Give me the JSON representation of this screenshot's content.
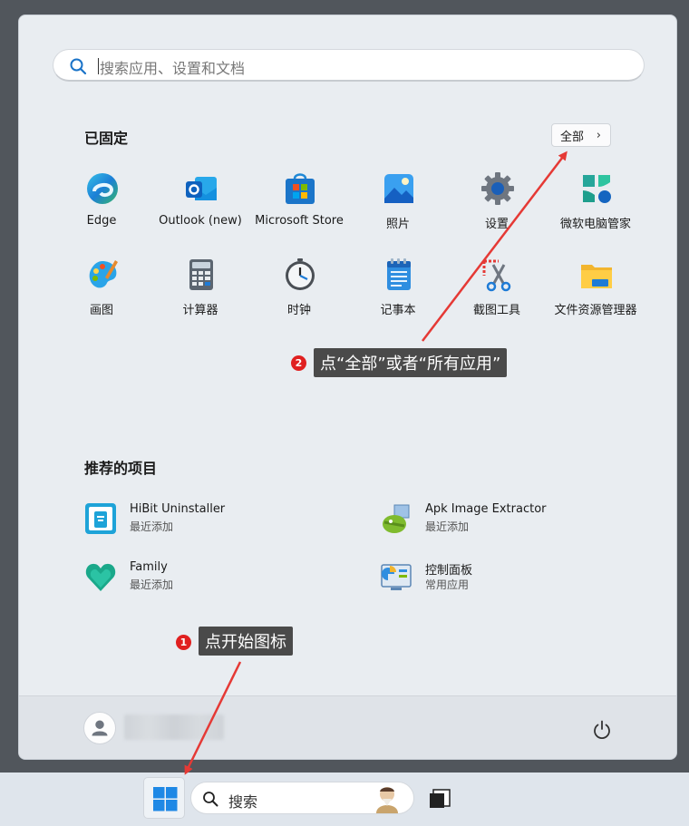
{
  "search": {
    "placeholder": "搜索应用、设置和文档"
  },
  "pinned": {
    "title": "已固定",
    "all_button": "全部",
    "apps": [
      {
        "label": "Edge",
        "icon": "edge-icon"
      },
      {
        "label": "Outlook (new)",
        "icon": "outlook-icon"
      },
      {
        "label": "Microsoft Store",
        "icon": "store-icon"
      },
      {
        "label": "照片",
        "icon": "photos-icon"
      },
      {
        "label": "设置",
        "icon": "settings-icon"
      },
      {
        "label": "微软电脑管家",
        "icon": "pc-manager-icon"
      },
      {
        "label": "画图",
        "icon": "paint-icon"
      },
      {
        "label": "计算器",
        "icon": "calculator-icon"
      },
      {
        "label": "时钟",
        "icon": "clock-icon"
      },
      {
        "label": "记事本",
        "icon": "notepad-icon"
      },
      {
        "label": "截图工具",
        "icon": "snipping-tool-icon"
      },
      {
        "label": "文件资源管理器",
        "icon": "file-explorer-icon"
      }
    ]
  },
  "recommended": {
    "title": "推荐的项目",
    "items": [
      {
        "name": "HiBit Uninstaller",
        "sub": "最近添加",
        "icon": "hibit-uninstaller-icon"
      },
      {
        "name": "Apk Image Extractor",
        "sub": "最近添加",
        "icon": "apk-extractor-icon"
      },
      {
        "name": "Family",
        "sub": "最近添加",
        "icon": "family-icon"
      },
      {
        "name": "控制面板",
        "sub": "常用应用",
        "icon": "control-panel-icon"
      }
    ]
  },
  "taskbar": {
    "search_label": "搜索"
  },
  "annotations": {
    "step1": {
      "number": "1",
      "text": "点开始图标"
    },
    "step2": {
      "number": "2",
      "text": "点“全部”或者“所有应用”"
    }
  },
  "colors": {
    "annotation_arrow": "#e53935",
    "tooltip_bg": "#4a4a4a",
    "badge": "#e02020"
  }
}
